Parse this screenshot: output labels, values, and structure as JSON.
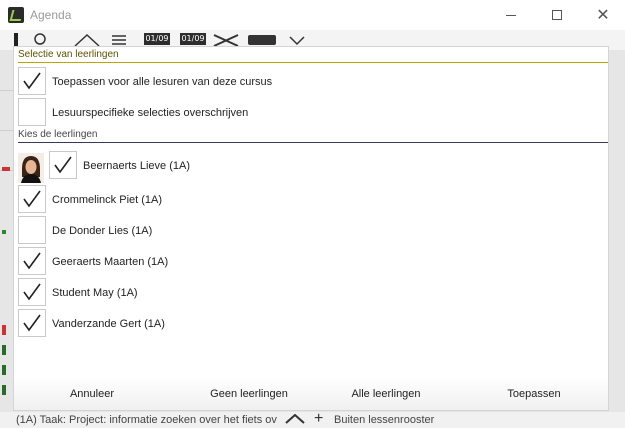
{
  "window": {
    "title": "Agenda",
    "minimize": "",
    "maximize": "",
    "close": "✕"
  },
  "background": {
    "toolbar_dates": [
      "01/09",
      "01/09"
    ],
    "bottom_task": "(1A) Taak: Project: informatie zoeken over het fiets ov",
    "bottom_outside": "Buiten lessenrooster"
  },
  "dialog": {
    "selection_header": "Selectie van leerlingen",
    "options": [
      {
        "label": "Toepassen voor alle lesuren van deze cursus",
        "checked": true
      },
      {
        "label": "Lesuurspecifieke selecties overschrijven",
        "checked": false
      }
    ],
    "students_header": "Kies de leerlingen",
    "students": [
      {
        "name": "Beernaerts Lieve (1A)",
        "checked": true,
        "has_photo": true
      },
      {
        "name": "Crommelinck Piet (1A)",
        "checked": true,
        "has_photo": false
      },
      {
        "name": "De Donder Lies (1A)",
        "checked": false,
        "has_photo": false
      },
      {
        "name": "Geeraerts Maarten (1A)",
        "checked": true,
        "has_photo": false
      },
      {
        "name": "Student May (1A)",
        "checked": true,
        "has_photo": false
      },
      {
        "name": "Vanderzande Gert (1A)",
        "checked": true,
        "has_photo": false
      }
    ],
    "buttons": {
      "cancel": "Annuleer",
      "none": "Geen leerlingen",
      "all": "Alle leerlingen",
      "apply": "Toepassen"
    }
  },
  "colors": {
    "header_rule_first": "#b8a800",
    "header_rule": "#3a3a5a"
  }
}
